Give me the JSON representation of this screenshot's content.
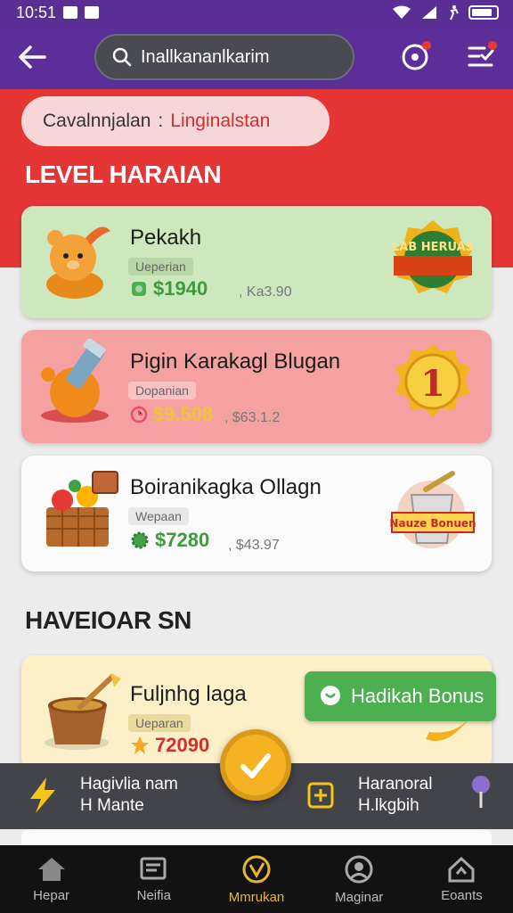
{
  "status_bar": {
    "time": "10:51"
  },
  "search": {
    "placeholder": "Inallkananlkarim"
  },
  "chip": {
    "label": "Cavalnnjalan",
    "sep": ":",
    "value": "Linginalstan"
  },
  "sections": [
    {
      "title": "LEVEL HARAIAN"
    },
    {
      "title": "HAVEIOAR SN"
    }
  ],
  "cards": [
    {
      "title": "Pekakh",
      "tag": "Ueperian",
      "price": "$1940",
      "old": ", Ka3.90",
      "badge": "LAB HERUAS"
    },
    {
      "title": "Pigin Karakagl Blugan",
      "tag": "Dopanian",
      "price": "$9.508",
      "old": ", $63.1.2",
      "badge": "1"
    },
    {
      "title": "Boiranikagka Ollagn",
      "tag": "Wepaan",
      "price": "$7280",
      "old": ", $43.97",
      "badge": "Nauze Bonuen"
    },
    {
      "title": "Fuljnhg laga",
      "tag": "Ueparan",
      "price": "72090"
    }
  ],
  "bonus_button": {
    "label": "Hadikah Bonus"
  },
  "floating_bar": {
    "left_line1": "Hagivlia nam",
    "left_line2": "H Mante",
    "right_line1": "Haranoral",
    "right_line2": "H.lkgbih"
  },
  "bottom_nav": [
    {
      "label": "Hepar",
      "icon": "home-icon"
    },
    {
      "label": "Neifia",
      "icon": "news-icon"
    },
    {
      "label": "Mmrukan",
      "icon": "check-circle-icon",
      "active": true
    },
    {
      "label": "Maginar",
      "icon": "profile-icon"
    },
    {
      "label": "Eoants",
      "icon": "house-outline-icon"
    }
  ],
  "colors": {
    "appbar": "#5c2e98",
    "hero": "#e53534",
    "accent": "#e8b829",
    "green": "#4caf50"
  }
}
